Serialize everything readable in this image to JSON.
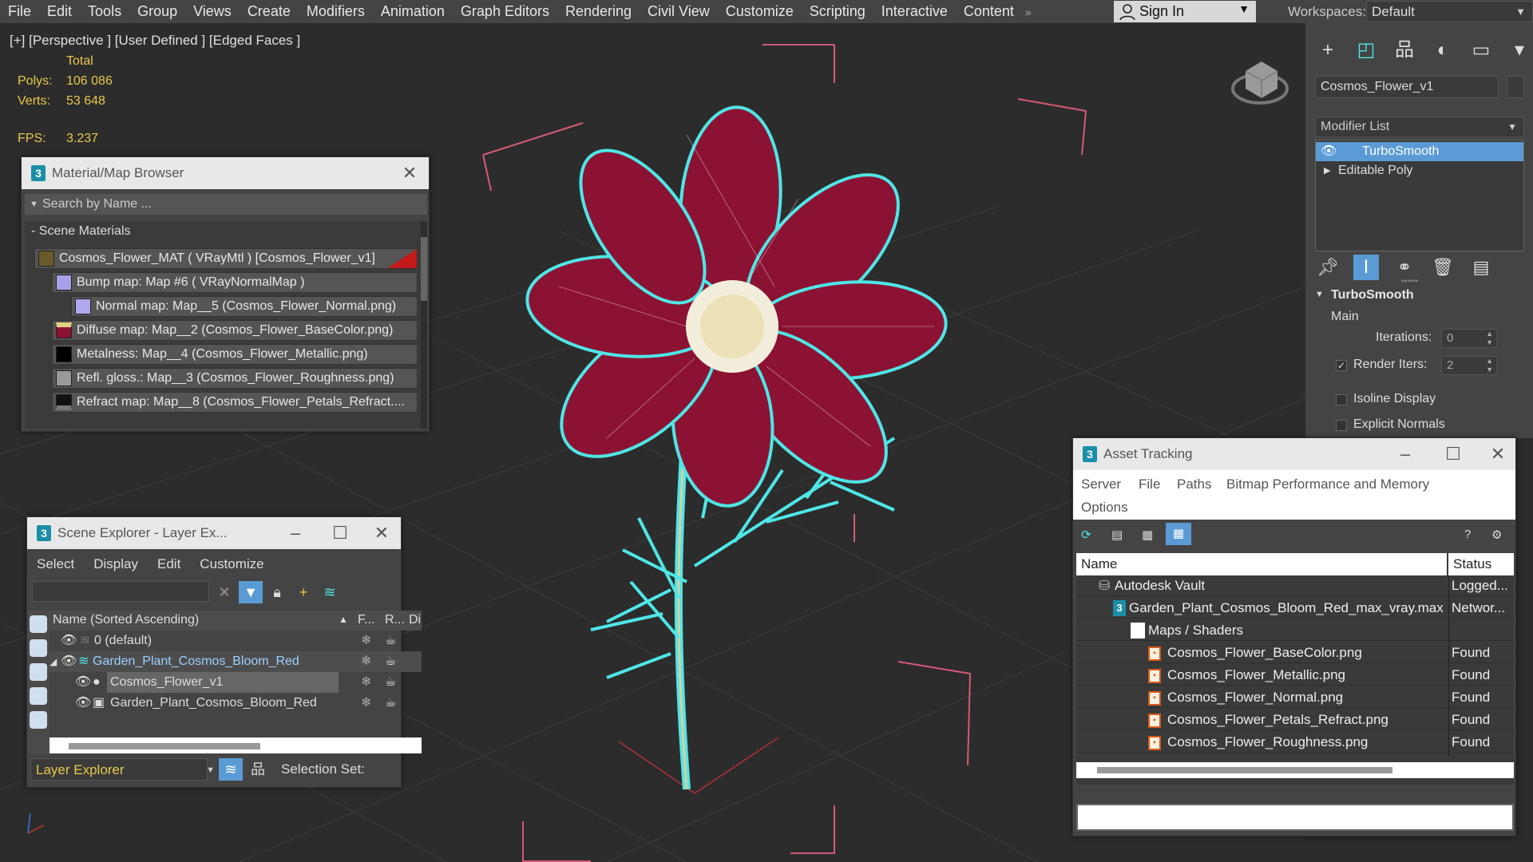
{
  "menubar": {
    "items": [
      "File",
      "Edit",
      "Tools",
      "Group",
      "Views",
      "Create",
      "Modifiers",
      "Animation",
      "Graph Editors",
      "Rendering",
      "Civil View",
      "Customize",
      "Scripting",
      "Interactive",
      "Content"
    ],
    "more": "»",
    "sign_in": "Sign In",
    "workspaces_label": "Workspaces:",
    "workspace_value": "Default"
  },
  "viewport": {
    "label": "[+] [Perspective ] [User Defined ] [Edged Faces ]",
    "stats": {
      "total_label": "Total",
      "polys_label": "Polys:",
      "polys_value": "106 086",
      "verts_label": "Verts:",
      "verts_value": "53 648",
      "fps_label": "FPS:",
      "fps_value": "3.237"
    }
  },
  "material_browser": {
    "title": "Material/Map Browser",
    "search_placeholder": "Search by Name ...",
    "group": "- Scene Materials",
    "rows": [
      "Cosmos_Flower_MAT  ( VRayMtl )  [Cosmos_Flower_v1]",
      "Bump map: Map #6  ( VRayNormalMap )",
      "Normal map: Map__5 (Cosmos_Flower_Normal.png)",
      "Diffuse map: Map__2 (Cosmos_Flower_BaseColor.png)",
      "Metalness: Map__4 (Cosmos_Flower_Metallic.png)",
      "Refl. gloss.: Map__3 (Cosmos_Flower_Roughness.png)",
      "Refract  map:  Map__8  (Cosmos_Flower_Petals_Refract...."
    ]
  },
  "scene_explorer": {
    "title": "Scene Explorer - Layer Ex...",
    "menu": [
      "Select",
      "Display",
      "Edit",
      "Customize"
    ],
    "col_name": "Name (Sorted Ascending)",
    "col_f": "F...",
    "col_r": "R...",
    "col_d": "Di",
    "rows": [
      "0 (default)",
      "Garden_Plant_Cosmos_Bloom_Red",
      "Cosmos_Flower_v1",
      "Garden_Plant_Cosmos_Bloom_Red"
    ],
    "layer_explorer": "Layer Explorer",
    "selection_set": "Selection Set:"
  },
  "command_panel": {
    "object_name": "Cosmos_Flower_v1",
    "modifier_list": "Modifier List",
    "stack": [
      "TurboSmooth",
      "Editable Poly"
    ],
    "rollout_title": "TurboSmooth",
    "main": "Main",
    "iterations_label": "Iterations:",
    "iterations_value": "0",
    "render_iters_label": "Render Iters:",
    "render_iters_value": "2",
    "isoline_label": "Isoline Display",
    "explicit_label": "Explicit Normals"
  },
  "asset_tracking": {
    "title": "Asset Tracking",
    "menu": [
      "Server",
      "File",
      "Paths",
      "Bitmap Performance and Memory",
      "Options"
    ],
    "col_name": "Name",
    "col_status": "Status",
    "rows": [
      {
        "name": "Autodesk Vault",
        "status": "Logged..."
      },
      {
        "name": "Garden_Plant_Cosmos_Bloom_Red_max_vray.max",
        "status": "Networ..."
      },
      {
        "name": "Maps / Shaders",
        "status": ""
      },
      {
        "name": "Cosmos_Flower_BaseColor.png",
        "status": "Found"
      },
      {
        "name": "Cosmos_Flower_Metallic.png",
        "status": "Found"
      },
      {
        "name": "Cosmos_Flower_Normal.png",
        "status": "Found"
      },
      {
        "name": "Cosmos_Flower_Petals_Refract.png",
        "status": "Found"
      },
      {
        "name": "Cosmos_Flower_Roughness.png",
        "status": "Found"
      }
    ]
  },
  "colors": {
    "accent": "#1b8fa7",
    "stat_yellow": "#e8c84a",
    "petal": "#8c1233",
    "wire_cyan": "#4fe6e6",
    "selection_blue": "#5b9bd5"
  }
}
